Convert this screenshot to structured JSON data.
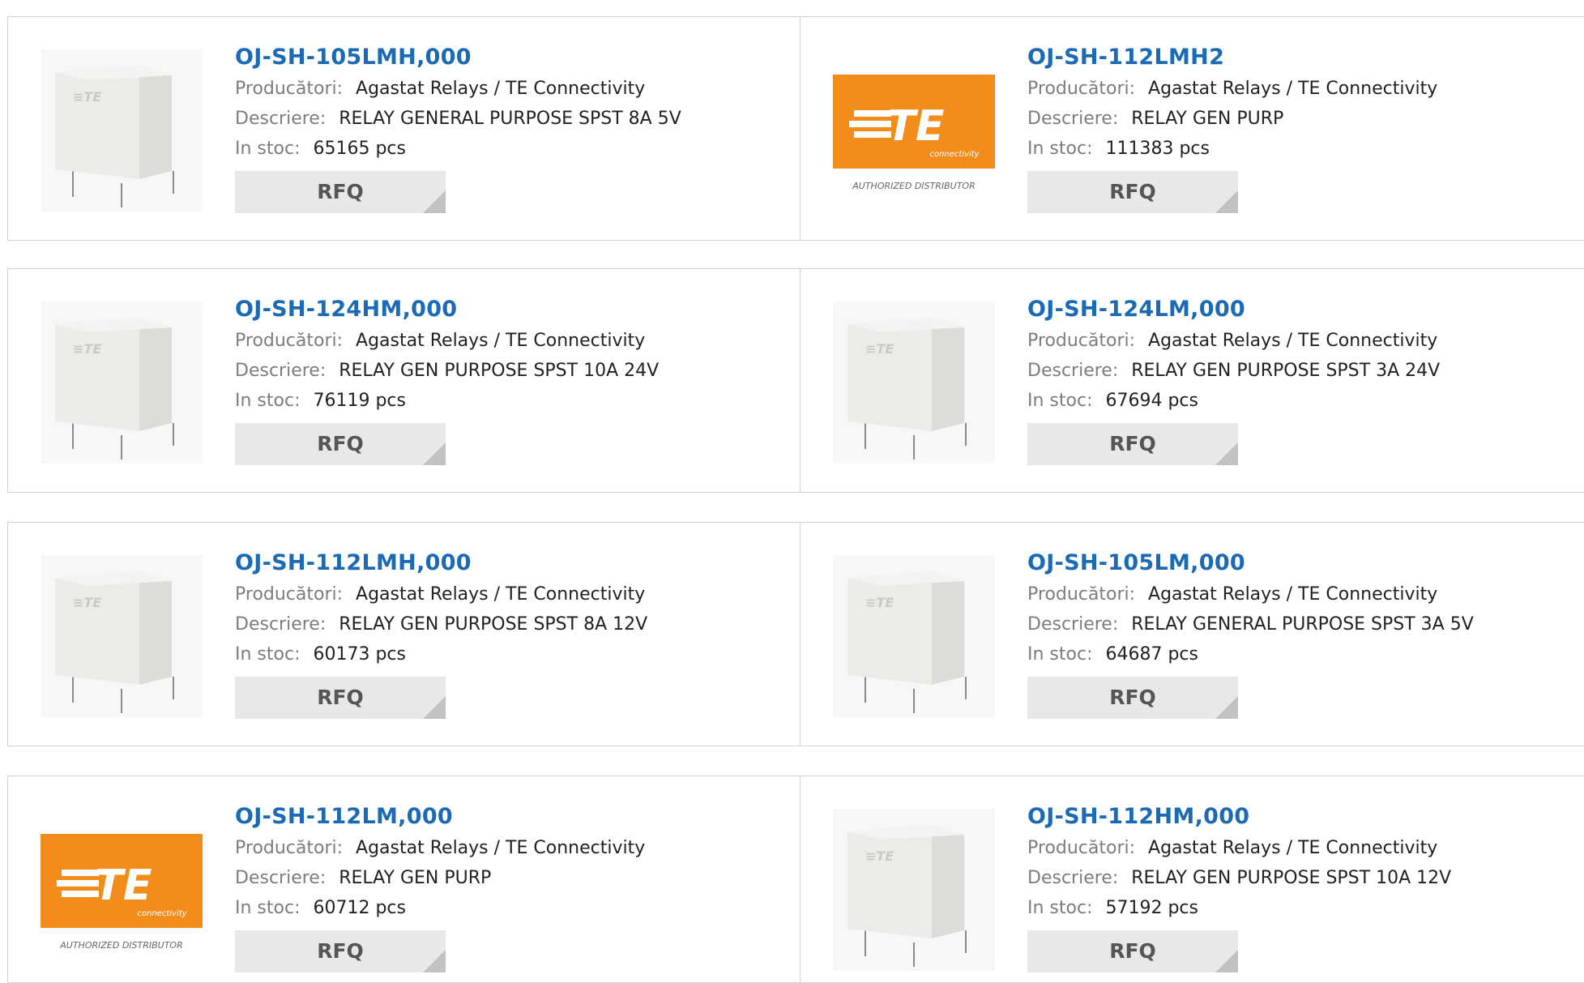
{
  "labels": {
    "manufacturer": "Producători:",
    "description": "Descriere:",
    "stock": "In stoc:"
  },
  "products": [
    {
      "part": "OJ-SH-105LMH,000",
      "manufacturer": "Agastat Relays / TE Connectivity",
      "description": "RELAY GENERAL PURPOSE SPST 8A 5V",
      "stock": "65165 pcs",
      "rfq": "RFQ",
      "image": "relay-photo"
    },
    {
      "part": "OJ-SH-112LMH2",
      "manufacturer": "Agastat Relays / TE Connectivity",
      "description": "RELAY GEN PURP",
      "stock": "111383 pcs",
      "rfq": "RFQ",
      "image": "te-logo"
    },
    {
      "part": "OJ-SH-124HM,000",
      "manufacturer": "Agastat Relays / TE Connectivity",
      "description": "RELAY GEN PURPOSE SPST 10A 24V",
      "stock": "76119 pcs",
      "rfq": "RFQ",
      "image": "relay-photo"
    },
    {
      "part": "OJ-SH-124LM,000",
      "manufacturer": "Agastat Relays / TE Connectivity",
      "description": "RELAY GEN PURPOSE SPST 3A 24V",
      "stock": "67694 pcs",
      "rfq": "RFQ",
      "image": "relay-photo"
    },
    {
      "part": "OJ-SH-112LMH,000",
      "manufacturer": "Agastat Relays / TE Connectivity",
      "description": "RELAY GEN PURPOSE SPST 8A 12V",
      "stock": "60173 pcs",
      "rfq": "RFQ",
      "image": "relay-photo"
    },
    {
      "part": "OJ-SH-105LM,000",
      "manufacturer": "Agastat Relays / TE Connectivity",
      "description": "RELAY GENERAL PURPOSE SPST 3A 5V",
      "stock": "64687 pcs",
      "rfq": "RFQ",
      "image": "relay-photo"
    },
    {
      "part": "OJ-SH-112LM,000",
      "manufacturer": "Agastat Relays / TE Connectivity",
      "description": "RELAY GEN PURP",
      "stock": "60712 pcs",
      "rfq": "RFQ",
      "image": "te-logo"
    },
    {
      "part": "OJ-SH-112HM,000",
      "manufacturer": "Agastat Relays / TE Connectivity",
      "description": "RELAY GEN PURPOSE SPST 10A 12V",
      "stock": "57192 pcs",
      "rfq": "RFQ",
      "image": "relay-photo"
    }
  ],
  "logo": {
    "brand": "TE",
    "tagline": "connectivity",
    "caption": "AUTHORIZED DISTRIBUTOR",
    "color": "#f28c1a"
  },
  "colors": {
    "title": "#1b6ab6",
    "label": "#7d7d7d",
    "rfq_bg": "#e8e8e8",
    "border": "#d2d2d2"
  }
}
